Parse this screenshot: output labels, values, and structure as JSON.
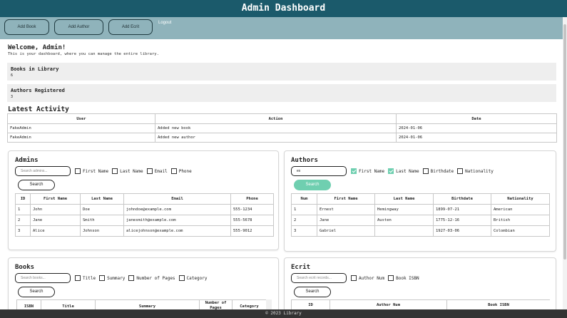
{
  "header": {
    "title": "Admin Dashboard"
  },
  "nav": {
    "add_book": "Add Book",
    "add_author": "Add Author",
    "add_ecrit": "Add Ecrit",
    "logout": "Logout"
  },
  "welcome": {
    "title": "Welcome, Admin!",
    "subtitle": "This is your dashboard, where you can manage the entire library."
  },
  "stats": {
    "books": {
      "label": "Books in Library",
      "value": "6"
    },
    "authors": {
      "label": "Authors Registered",
      "value": "3"
    }
  },
  "activity": {
    "title": "Latest Activity",
    "headers": [
      "User",
      "Action",
      "Date"
    ],
    "rows": [
      [
        "FakeAdmin",
        "Added new book",
        "2024-01-06"
      ],
      [
        "FakeAdmin",
        "Added new author",
        "2024-01-06"
      ]
    ]
  },
  "admins": {
    "title": "Admins",
    "search_placeholder": "Search admins...",
    "filters": [
      "First Name",
      "Last Name",
      "Email",
      "Phone"
    ],
    "search_label": "Search",
    "headers": [
      "ID",
      "First Name",
      "Last Name",
      "Email",
      "Phone"
    ],
    "rows": [
      [
        "1",
        "John",
        "Doe",
        "johndoe@example.com",
        "555-1234"
      ],
      [
        "2",
        "Jane",
        "Smith",
        "janesmith@example.com",
        "555-5678"
      ],
      [
        "3",
        "Alice",
        "Johnson",
        "alicejohnson@example.com",
        "555-9012"
      ]
    ]
  },
  "authors": {
    "title": "Authors",
    "search_value": "ex",
    "filters": [
      "First Name",
      "Last Name",
      "Birthdate",
      "Nationality"
    ],
    "filters_checked": [
      true,
      true,
      false,
      false
    ],
    "search_label": "Search",
    "headers": [
      "Num",
      "First Name",
      "Last Name",
      "Birthdate",
      "Nationality"
    ],
    "rows": [
      [
        "1",
        "Ernest",
        "Hemingway",
        "1899-07-21",
        "American"
      ],
      [
        "2",
        "Jane",
        "Austen",
        "1775-12-16",
        "British"
      ],
      [
        "3",
        "Gabriel",
        "",
        "1927-03-06",
        "Colombian"
      ]
    ]
  },
  "books": {
    "title": "Books",
    "search_placeholder": "Search books...",
    "filters": [
      "Title",
      "Summary",
      "Number of Pages",
      "Category"
    ],
    "search_label": "Search",
    "headers": [
      "ISBN",
      "Title",
      "Summary",
      "Number of Pages",
      "Category"
    ]
  },
  "ecrit": {
    "title": "Ecrit",
    "search_placeholder": "Search ecrit records...",
    "filters": [
      "Author Num",
      "Book ISBN"
    ],
    "search_label": "Search",
    "headers": [
      "ID",
      "Author Num",
      "Book ISBN"
    ]
  },
  "footer": {
    "text": "© 2023 Library"
  },
  "colors": {
    "header": "#1b5a6b",
    "navbar": "#8fb3bb",
    "accent": "#6fcfb0",
    "footer": "#333333"
  }
}
